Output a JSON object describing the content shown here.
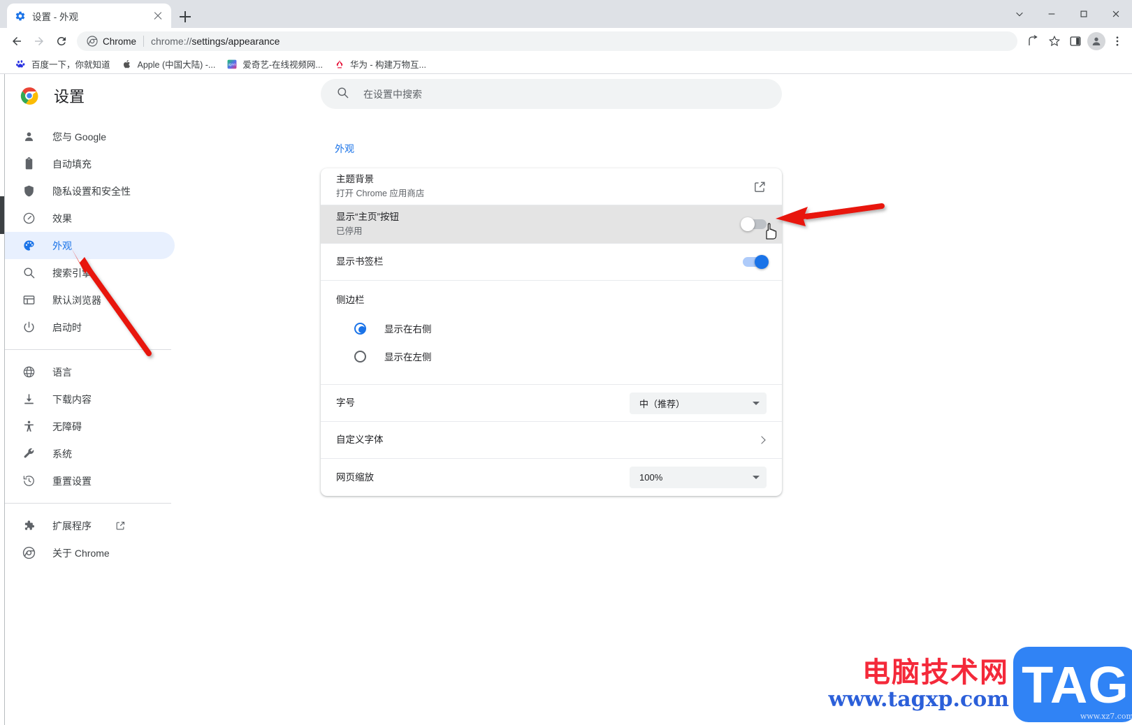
{
  "window": {
    "controls": {
      "minimize_tabs_label": "chevron-down",
      "minimize_label": "—",
      "maximize_label": "□",
      "close_label": "✕"
    }
  },
  "tabstrip": {
    "tab": {
      "title": "设置 - 外观",
      "favicon": "settings-gear-icon",
      "close_label": "×"
    },
    "new_tab_label": "+"
  },
  "toolbar": {
    "back_label": "←",
    "forward_label": "→",
    "reload_label": "⟳",
    "omnibox": {
      "chip_label": "Chrome",
      "url_scheme": "chrome://",
      "url_rest": "settings/appearance"
    },
    "share_label": "share-icon",
    "bookmark_label": "star-icon",
    "sidepanel_label": "side-panel-icon",
    "profile_label": "profile-avatar",
    "menu_label": "⋮"
  },
  "bookmarks": [
    {
      "label": "百度一下，你就知道",
      "icon": "baidu-favicon"
    },
    {
      "label": "Apple (中国大陆) -...",
      "icon": "apple-favicon"
    },
    {
      "label": "爱奇艺-在线视频网...",
      "icon": "iqiyi-favicon"
    },
    {
      "label": "华为 - 构建万物互...",
      "icon": "huawei-favicon"
    }
  ],
  "sidebar": {
    "brand_title": "设置",
    "brand_icon": "chrome-logo",
    "groups": [
      {
        "items": [
          {
            "label": "您与 Google",
            "icon": "person-icon",
            "active": false
          },
          {
            "label": "自动填充",
            "icon": "clipboard-icon",
            "active": false
          },
          {
            "label": "隐私设置和安全性",
            "icon": "shield-icon",
            "active": false
          },
          {
            "label": "效果",
            "icon": "speedometer-icon",
            "active": false
          },
          {
            "label": "外观",
            "icon": "palette-icon",
            "active": true
          },
          {
            "label": "搜索引擎",
            "icon": "search-icon",
            "active": false
          },
          {
            "label": "默认浏览器",
            "icon": "browser-window-icon",
            "active": false
          },
          {
            "label": "启动时",
            "icon": "power-icon",
            "active": false
          }
        ]
      },
      {
        "items": [
          {
            "label": "语言",
            "icon": "globe-icon",
            "active": false
          },
          {
            "label": "下载内容",
            "icon": "download-icon",
            "active": false
          },
          {
            "label": "无障碍",
            "icon": "accessibility-icon",
            "active": false
          },
          {
            "label": "系统",
            "icon": "wrench-icon",
            "active": false
          },
          {
            "label": "重置设置",
            "icon": "history-restore-icon",
            "active": false
          }
        ]
      },
      {
        "items": [
          {
            "label": "扩展程序",
            "icon": "puzzle-icon",
            "active": false,
            "external": true
          },
          {
            "label": "关于 Chrome",
            "icon": "chrome-outline-icon",
            "active": false
          }
        ]
      }
    ]
  },
  "main": {
    "search": {
      "placeholder": "在设置中搜索",
      "icon": "search-icon"
    },
    "section_title": "外观",
    "rows": [
      {
        "name": "theme",
        "title": "主题背景",
        "subtitle": "打开 Chrome 应用商店",
        "control": "external-link"
      },
      {
        "name": "show-home-button",
        "title": "显示“主页”按钮",
        "subtitle": "已停用",
        "control": "toggle",
        "toggle_state": "off",
        "hovered": true
      },
      {
        "name": "show-bookmarks-bar",
        "title": "显示书签栏",
        "subtitle": "",
        "control": "toggle",
        "toggle_state": "on"
      }
    ],
    "sidebar_group": {
      "title": "侧边栏",
      "options": [
        {
          "label": "显示在右侧",
          "checked": true
        },
        {
          "label": "显示在左侧",
          "checked": false
        }
      ]
    },
    "font_size": {
      "label": "字号",
      "value": "中（推荐）"
    },
    "customize_fonts": {
      "label": "自定义字体"
    },
    "page_zoom": {
      "label": "网页缩放",
      "value": "100%"
    }
  },
  "annotations": {
    "arrow_to_toggle": "red-arrow",
    "arrow_to_appearance": "red-arrow",
    "cursor": "pointing-hand-cursor"
  },
  "watermark": {
    "line1": "电脑技术网",
    "line2": "www.tagxp.com",
    "badge": "TAG",
    "badge_sub": "www.xz7.com"
  },
  "colors": {
    "accent": "#1a73e8",
    "active_bg": "#e8f0fe",
    "toolbar_bg": "#dee1e6",
    "field_bg": "#f1f3f4",
    "annotation_red": "#e8120c",
    "watermark_red": "#f4293a",
    "watermark_blue": "#2b5fd9",
    "badge_blue": "#3083f5"
  }
}
